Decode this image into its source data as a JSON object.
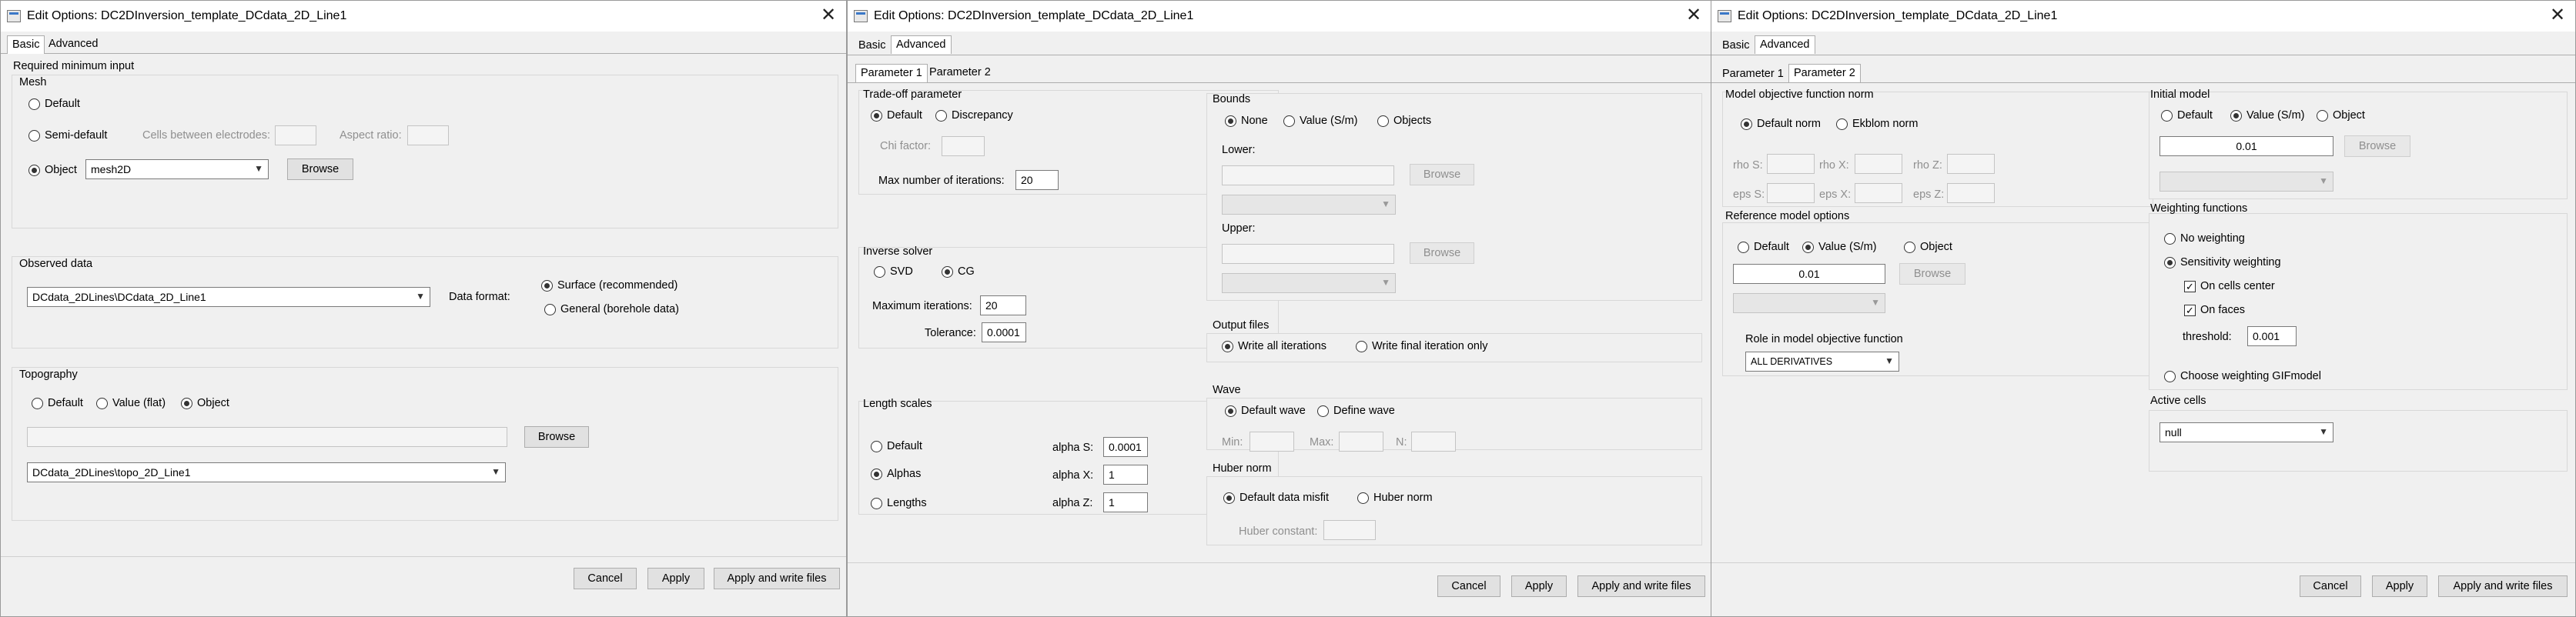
{
  "window_title": "Edit Options: DC2DInversion_template_DCdata_2D_Line1",
  "close_glyph": "✕",
  "main_tabs": [
    "Basic",
    "Advanced"
  ],
  "sub_tabs": [
    "Parameter 1",
    "Parameter 2"
  ],
  "footer": {
    "cancel": "Cancel",
    "apply": "Apply",
    "apply_write": "Apply and write files"
  },
  "browse": "Browse",
  "basic": {
    "required_title": "Required minimum input",
    "mesh": {
      "title": "Mesh",
      "default": "Default",
      "semi_default": "Semi-default",
      "cells_between": "Cells between electrodes:",
      "aspect_ratio": "Aspect ratio:",
      "object": "Object",
      "object_value": "mesh2D"
    },
    "observed": {
      "title": "Observed data",
      "value": "DCdata_2DLines\\DCdata_2D_Line1",
      "format_label": "Data format:",
      "surface": "Surface (recommended)",
      "borehole": "General (borehole data)"
    },
    "topography": {
      "title": "Topography",
      "default": "Default",
      "value_flat": "Value (flat)",
      "object": "Object",
      "object_value": "DCdata_2DLines\\topo_2D_Line1"
    }
  },
  "param1": {
    "tradeoff": {
      "title": "Trade-off parameter",
      "default": "Default",
      "discrepancy": "Discrepancy",
      "chi_factor": "Chi factor:",
      "max_iter_label": "Max number of iterations:",
      "max_iter": "20"
    },
    "solver": {
      "title": "Inverse solver",
      "svd": "SVD",
      "cg": "CG",
      "max_iter_label": "Maximum iterations:",
      "max_iter": "20",
      "tol_label": "Tolerance:",
      "tol": "0.0001"
    },
    "length": {
      "title": "Length scales",
      "default": "Default",
      "alphas": "Alphas",
      "lengths": "Lengths",
      "alpha_s_label": "alpha S:",
      "alpha_s": "0.0001",
      "alpha_x_label": "alpha X:",
      "alpha_x": "1",
      "alpha_z_label": "alpha Z:",
      "alpha_z": "1"
    },
    "bounds": {
      "title": "Bounds",
      "none": "None",
      "value": "Value (S/m)",
      "objects": "Objects",
      "lower": "Lower:",
      "upper": "Upper:"
    },
    "output": {
      "title": "Output files",
      "all": "Write all iterations",
      "final": "Write final iteration only"
    },
    "wave": {
      "title": "Wave",
      "default": "Default wave",
      "define": "Define wave",
      "min": "Min:",
      "max": "Max:",
      "n": "N:"
    },
    "huber": {
      "title": "Huber norm",
      "default": "Default data misfit",
      "huber": "Huber norm",
      "constant": "Huber constant:"
    }
  },
  "param2": {
    "model_norm": {
      "title": "Model objective function norm",
      "default": "Default norm",
      "ekblom": "Ekblom norm",
      "rho_s": "rho S:",
      "rho_x": "rho X:",
      "rho_z": "rho Z:",
      "eps_s": "eps S:",
      "eps_x": "eps X:",
      "eps_z": "eps Z:"
    },
    "reference": {
      "title": "Reference model options",
      "default": "Default",
      "value": "Value (S/m)",
      "object": "Object",
      "value_input": "0.01",
      "role_label": "Role in model objective function",
      "role_value": "ALL DERIVATIVES"
    },
    "initial": {
      "title": "Initial model",
      "default": "Default",
      "value": "Value (S/m)",
      "object": "Object",
      "value_input": "0.01"
    },
    "weighting": {
      "title": "Weighting functions",
      "none": "No weighting",
      "sensitivity": "Sensitivity weighting",
      "cells_center": "On cells center",
      "faces": "On faces",
      "threshold_label": "threshold:",
      "threshold": "0.001",
      "gif": "Choose weighting GIFmodel"
    },
    "active": {
      "title": "Active cells",
      "value": "null"
    }
  }
}
